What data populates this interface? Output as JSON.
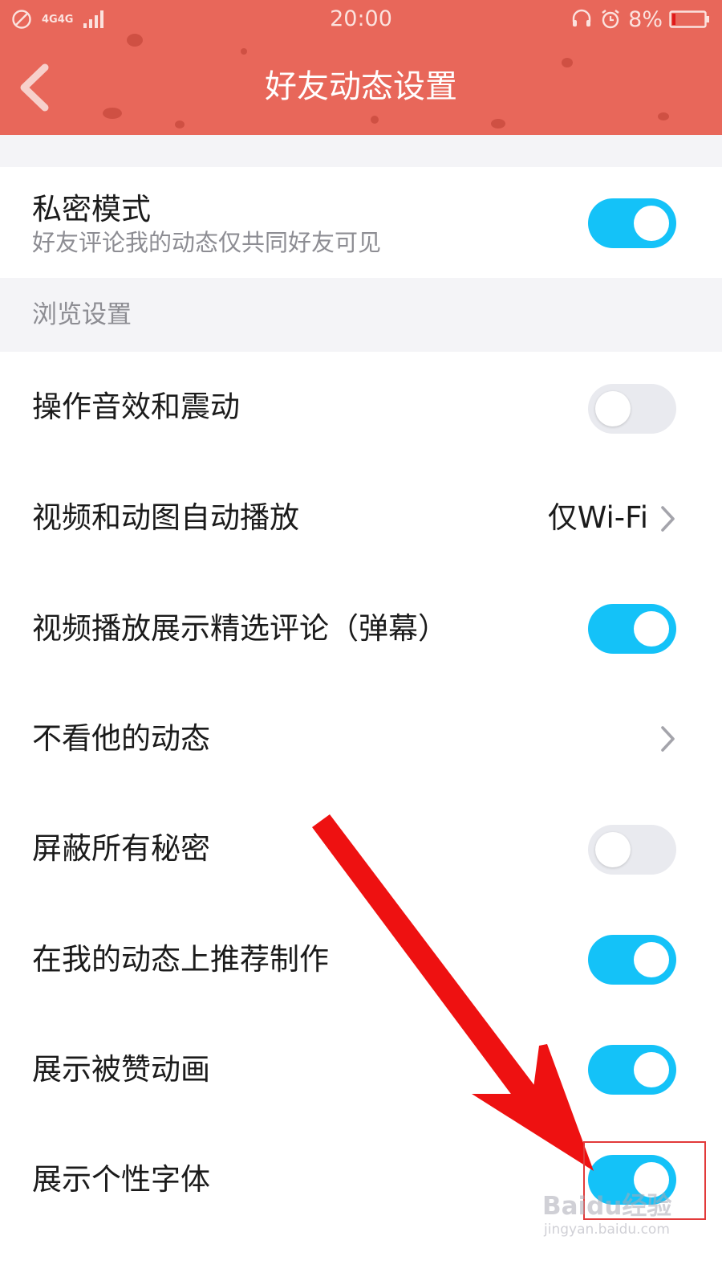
{
  "status_bar": {
    "network": "4G4G",
    "time": "20:00",
    "battery": "8%"
  },
  "header": {
    "title": "好友动态设置",
    "background_color": "#e8675a"
  },
  "privacy": {
    "title": "私密模式",
    "subtitle": "好友评论我的动态仅共同好友可见",
    "enabled": true
  },
  "section": {
    "label": "浏览设置"
  },
  "rows": [
    {
      "title": "操作音效和震动",
      "control": "toggle",
      "enabled": false
    },
    {
      "title": "视频和动图自动播放",
      "control": "value",
      "value": "仅Wi-Fi"
    },
    {
      "title": "视频播放展示精选评论（弹幕）",
      "control": "toggle",
      "enabled": true
    },
    {
      "title": "不看他的动态",
      "control": "chevron"
    },
    {
      "title": "屏蔽所有秘密",
      "control": "toggle",
      "enabled": false
    },
    {
      "title": "在我的动态上推荐制作",
      "control": "toggle",
      "enabled": true
    },
    {
      "title": "展示被赞动画",
      "control": "toggle",
      "enabled": true
    },
    {
      "title": "展示个性字体",
      "control": "toggle",
      "enabled": true
    }
  ],
  "colors": {
    "toggle_on": "#14c2f8",
    "toggle_off": "#e9eaef",
    "annotation_arrow": "#ee1111"
  },
  "watermark": {
    "brand": "Baidu经验",
    "url": "jingyan.baidu.com"
  }
}
